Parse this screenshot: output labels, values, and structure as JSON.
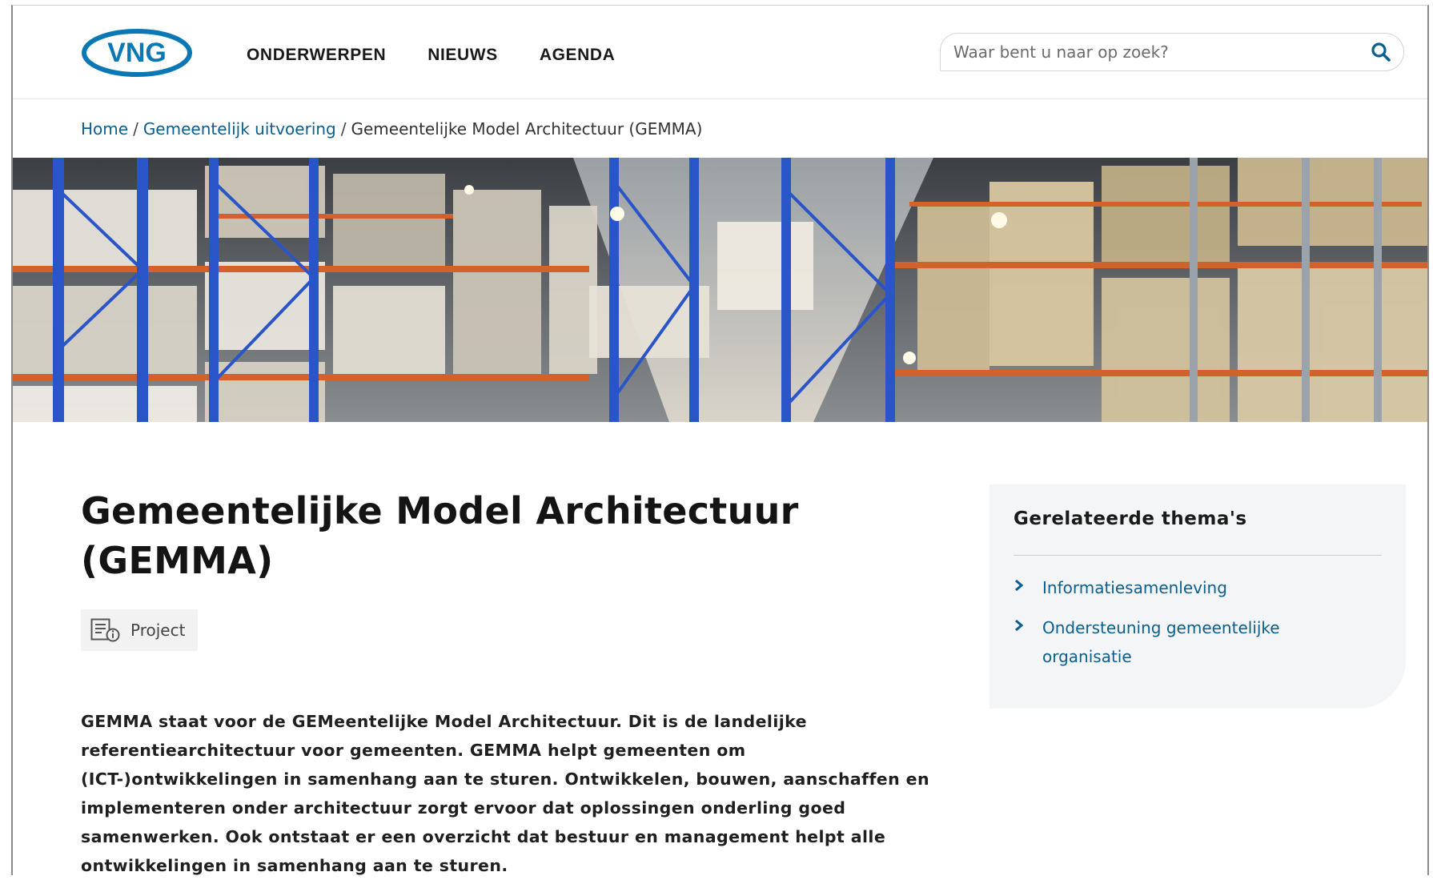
{
  "brand": {
    "logo_text": "VNG",
    "primary_color": "#0a78b4",
    "link_color": "#0a5f8f"
  },
  "nav": {
    "items": [
      "ONDERWERPEN",
      "NIEUWS",
      "AGENDA"
    ]
  },
  "search": {
    "placeholder": "Waar bent u naar op zoek?",
    "icon": "search-icon"
  },
  "breadcrumb": {
    "items": [
      {
        "label": "Home",
        "link": true
      },
      {
        "label": "Gemeentelijk uitvoering",
        "link": true
      },
      {
        "label": "Gemeentelijke Model Architectuur (GEMMA)",
        "link": false
      }
    ],
    "separator": "/"
  },
  "hero": {
    "icon": "warehouse-image"
  },
  "main": {
    "title": "Gemeentelijke Model Architectuur (GEMMA)",
    "tag": {
      "label": "Project",
      "icon": "project-info-icon"
    },
    "intro": "GEMMA staat voor de GEMeentelijke Model Architectuur. Dit is de landelijke referentiearchitectuur voor gemeenten. GEMMA helpt gemeenten om (ICT-)ontwikkelingen in samenhang aan te sturen. Ontwikkelen, bouwen, aanschaffen en implementeren onder architectuur zorgt ervoor dat oplossingen onderling goed samenwerken. Ook ontstaat er een overzicht dat bestuur en management helpt alle ontwikkelingen in samenhang aan te sturen."
  },
  "related": {
    "title": "Gerelateerde thema's",
    "items": [
      {
        "label": "Informatiesamenleving",
        "icon": "chevron-right-icon"
      },
      {
        "label": "Ondersteuning gemeentelijke organisatie",
        "icon": "chevron-right-icon"
      }
    ]
  }
}
